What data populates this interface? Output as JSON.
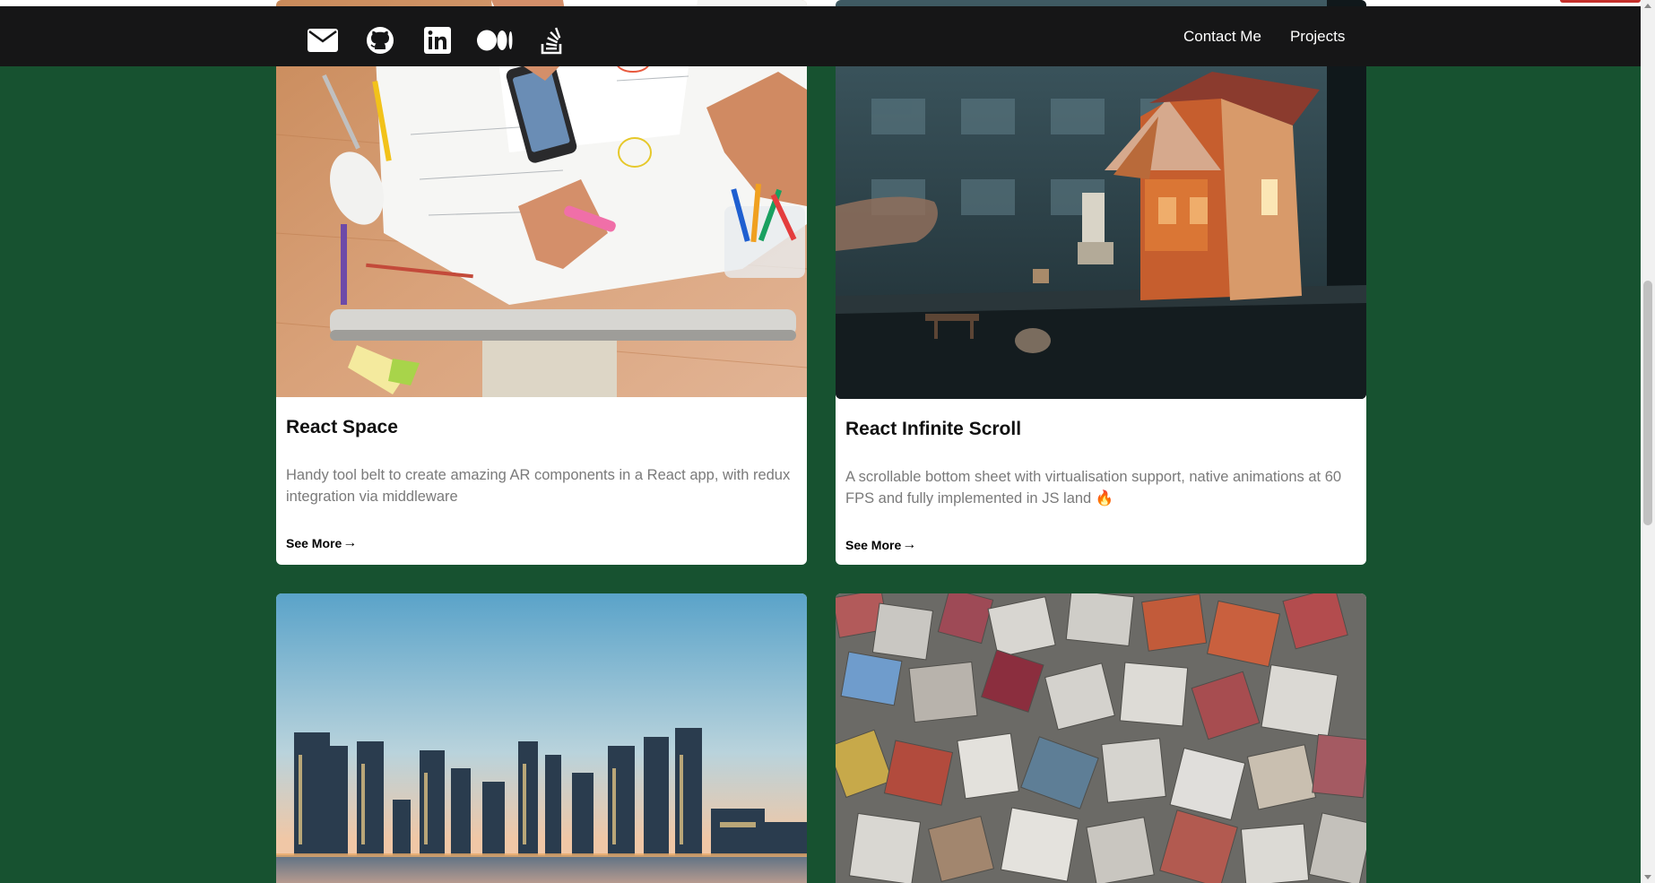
{
  "nav": {
    "social_icons": [
      "email-icon",
      "github-icon",
      "linkedin-icon",
      "medium-icon",
      "stackoverflow-icon"
    ],
    "links": [
      "Contact Me",
      "Projects"
    ]
  },
  "colors": {
    "background": "#175230",
    "navbar": "#161617",
    "card": "#ffffff",
    "title": "#111111",
    "description": "#7a7a7a"
  },
  "projects": [
    {
      "title": "React Space",
      "description": "Handy tool belt to create amazing AR components in a React app, with redux integration via middleware",
      "link": "See More",
      "image": "desk-with-phone-and-sketches"
    },
    {
      "title": "React Infinite Scroll",
      "description": "A scrollable bottom sheet with virtualisation support, native animations at 60 FPS and fully implemented in JS land 🔥",
      "link": "See More",
      "image": "toy-house-by-window"
    },
    {
      "title": "",
      "description": "",
      "link": "",
      "image": "city-skyline-at-dusk"
    },
    {
      "title": "",
      "description": "",
      "link": "",
      "image": "colorful-stone-blocks"
    }
  ]
}
